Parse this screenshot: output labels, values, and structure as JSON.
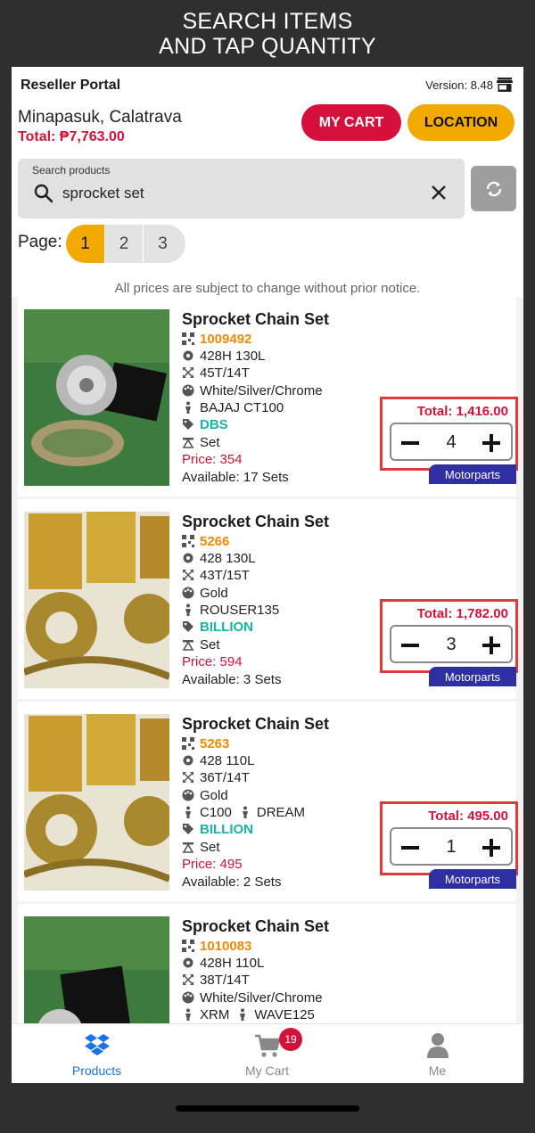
{
  "banner": {
    "line1": "SEARCH ITEMS",
    "line2": "AND TAP QUANTITY"
  },
  "header": {
    "title": "Reseller Portal",
    "version": "Version: 8.48"
  },
  "account": {
    "location": "Minapasuk, Calatrava",
    "total": "Total: ₱7,763.00"
  },
  "buttons": {
    "cart": "MY CART",
    "location": "LOCATION"
  },
  "search": {
    "label": "Search products",
    "value": "sprocket set"
  },
  "pagination": {
    "label": "Page:",
    "pages": [
      "1",
      "2",
      "3"
    ],
    "active": "1"
  },
  "notice": "All prices are subject to change without prior notice.",
  "products": [
    {
      "name": "Sprocket Chain Set",
      "code": "1009492",
      "spec": "428H 130L",
      "teeth": "45T/14T",
      "color": "White/Silver/Chrome",
      "models": [
        "BAJAJ CT100"
      ],
      "brand": "DBS",
      "unit": "Set",
      "price": "Price: 354",
      "available": "Available: 17 Sets",
      "line_total": "Total: 1,416.00",
      "qty": "4",
      "category": "Motorparts"
    },
    {
      "name": "Sprocket Chain Set",
      "code": "5266",
      "spec": "428 130L",
      "teeth": "43T/15T",
      "color": "Gold",
      "models": [
        "ROUSER135"
      ],
      "brand": "BILLION",
      "unit": "Set",
      "price": "Price: 594",
      "available": "Available: 3 Sets",
      "line_total": "Total: 1,782.00",
      "qty": "3",
      "category": "Motorparts"
    },
    {
      "name": "Sprocket Chain Set",
      "code": "5263",
      "spec": "428 110L",
      "teeth": "36T/14T",
      "color": "Gold",
      "models": [
        "C100",
        "DREAM"
      ],
      "brand": "BILLION",
      "unit": "Set",
      "price": "Price: 495",
      "available": "Available: 2 Sets",
      "line_total": "Total: 495.00",
      "qty": "1",
      "category": "Motorparts"
    },
    {
      "name": "Sprocket Chain Set",
      "code": "1010083",
      "spec": "428H 110L",
      "teeth": "38T/14T",
      "color": "White/Silver/Chrome",
      "models": [
        "XRM",
        "WAVE125"
      ]
    }
  ],
  "tabs": {
    "products": "Products",
    "cart": "My Cart",
    "cart_count": "19",
    "me": "Me"
  },
  "colors": {
    "accent_red": "#d5103a",
    "accent_yellow": "#f2a900",
    "brand_teal": "#17b3a8",
    "code_orange": "#f08a00",
    "badge_blue": "#2e2fa3",
    "tab_active": "#1a73e8"
  },
  "icons": [
    "store-icon",
    "search-icon",
    "clear-icon",
    "refresh-icon",
    "qr-icon",
    "gear-icon",
    "size-icon",
    "palette-icon",
    "motorcycle-icon",
    "tag-icon",
    "unit-icon",
    "dropbox-icon",
    "cart-icon",
    "person-icon"
  ]
}
